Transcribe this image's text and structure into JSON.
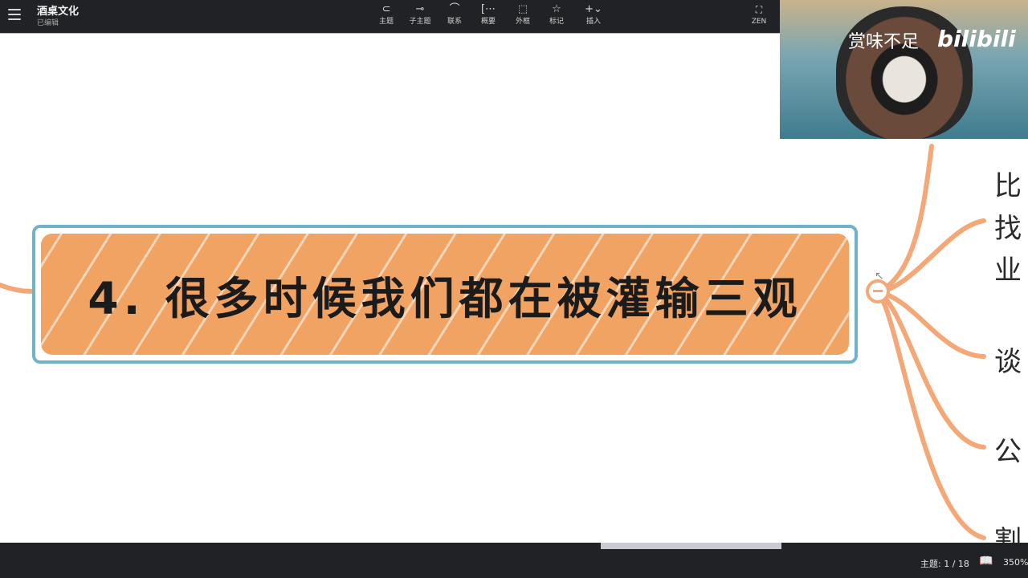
{
  "toolbar": {
    "doc_title": "酒桌文化",
    "doc_status": "已编辑",
    "tools": [
      {
        "name": "topic",
        "label": "主题",
        "icon": "⊂"
      },
      {
        "name": "subtopic",
        "label": "子主题",
        "icon": "⊸"
      },
      {
        "name": "relationship",
        "label": "联系",
        "icon": "⌒"
      },
      {
        "name": "summary",
        "label": "概要",
        "icon": "[⋯"
      },
      {
        "name": "boundary",
        "label": "外框",
        "icon": "⬚"
      },
      {
        "name": "marker",
        "label": "标记",
        "icon": "☆"
      },
      {
        "name": "insert",
        "label": "插入",
        "icon": "+⌄"
      }
    ],
    "zen_label": "ZEN",
    "zen_icon": "⛶"
  },
  "canvas": {
    "central_topic": "4. 很多时候我们都在被灌输三观",
    "branch_labels": [
      "比",
      "找",
      "业",
      "谈",
      "公",
      "割"
    ],
    "colors": {
      "branch": "#f5a877",
      "topic_fill": "#f0a363",
      "topic_border": "#6fb3c9"
    }
  },
  "video_overlay": {
    "watermark_text": "赏味不足",
    "watermark_logo": "bilibili"
  },
  "statusbar": {
    "topic_count": "主题: 1 / 18",
    "zoom": "350%"
  }
}
